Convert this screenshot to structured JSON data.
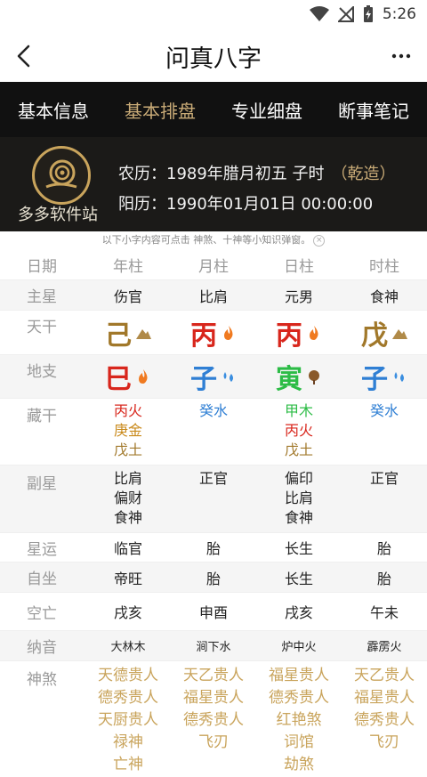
{
  "status": {
    "time": "5:26"
  },
  "appbar": {
    "title": "问真八字"
  },
  "tabs": [
    {
      "label": "基本信息"
    },
    {
      "label": "基本排盘"
    },
    {
      "label": "专业细盘"
    },
    {
      "label": "断事笔记"
    }
  ],
  "profile": {
    "logo_text": "多多软件站",
    "lunar": "农历：1989年腊月初五 子时",
    "gender": "（乾造）",
    "solar": "阳历：1990年01月01日 00:00:00"
  },
  "hint": "以下小字内容可点击 神煞、十神等小知识弹窗。",
  "table": {
    "header": {
      "label": "日期",
      "cols": [
        "年柱",
        "月柱",
        "日柱",
        "时柱"
      ]
    },
    "zhuxing": {
      "label": "主星",
      "cols": [
        "伤官",
        "比肩",
        "元男",
        "食神"
      ]
    },
    "tiangan": {
      "label": "天干",
      "cols": [
        "己",
        "丙",
        "丙",
        "戊"
      ]
    },
    "dizhi": {
      "label": "地支",
      "cols": [
        "巳",
        "子",
        "寅",
        "子"
      ]
    },
    "canggan": {
      "label": "藏干",
      "cols": [
        [
          "丙火",
          "庚金",
          "戊土"
        ],
        [
          "癸水"
        ],
        [
          "甲木",
          "丙火",
          "戊土"
        ],
        [
          "癸水"
        ]
      ]
    },
    "fuxing": {
      "label": "副星",
      "cols": [
        [
          "比肩",
          "偏财",
          "食神"
        ],
        [
          "正官"
        ],
        [
          "偏印",
          "比肩",
          "食神"
        ],
        [
          "正官"
        ]
      ]
    },
    "xingyun": {
      "label": "星运",
      "cols": [
        "临官",
        "胎",
        "长生",
        "胎"
      ]
    },
    "zizuo": {
      "label": "自坐",
      "cols": [
        "帝旺",
        "胎",
        "长生",
        "胎"
      ]
    },
    "kongwang": {
      "label": "空亡",
      "cols": [
        "戌亥",
        "申酉",
        "戌亥",
        "午未"
      ]
    },
    "nayin": {
      "label": "纳音",
      "cols": [
        "大林木",
        "涧下水",
        "炉中火",
        "霹雳火"
      ]
    },
    "shensha": {
      "label": "神煞",
      "cols": [
        [
          "天德贵人",
          "德秀贵人",
          "天厨贵人",
          "禄神",
          "亡神"
        ],
        [
          "天乙贵人",
          "福星贵人",
          "德秀贵人",
          "飞刃"
        ],
        [
          "福星贵人",
          "德秀贵人",
          "红艳煞",
          "词馆",
          "劫煞"
        ],
        [
          "天乙贵人",
          "福星贵人",
          "德秀贵人",
          "飞刃"
        ]
      ]
    }
  },
  "colors": {
    "gold": "#c9ab77",
    "fire": "#d8261c",
    "water": "#2f7fd4",
    "wood": "#2cbc46",
    "earth": "#a1782a"
  }
}
